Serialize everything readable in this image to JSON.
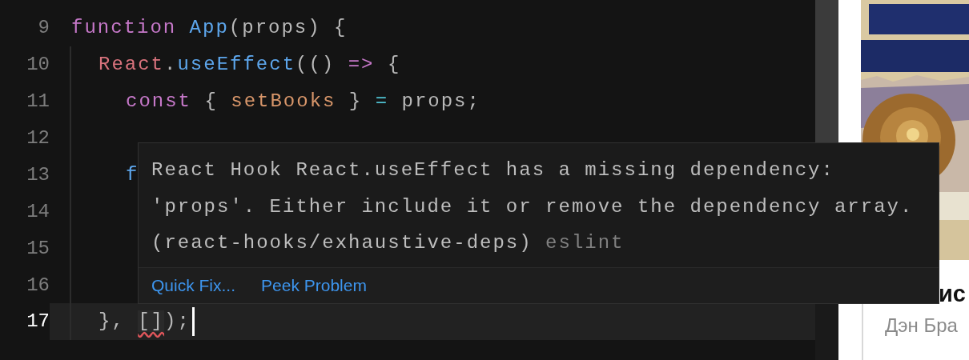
{
  "editor": {
    "lines": [
      {
        "number": "9",
        "current": false,
        "tokens": [
          {
            "text": "function",
            "kind": "keyword",
            "error": false
          },
          {
            "text": " App",
            "kind": "function",
            "error": false
          },
          {
            "text": "(props) {",
            "kind": "punctuation",
            "error": false
          }
        ],
        "children": [
          {
            "number": "10",
            "current": false,
            "tokens": [
              {
                "text": "React",
                "kind": "object",
                "error": false
              },
              {
                "text": ".",
                "kind": "punctuation",
                "error": false
              },
              {
                "text": "useEffect",
                "kind": "function",
                "error": false
              },
              {
                "text": "(()",
                "kind": "punctuation",
                "error": false
              },
              {
                "text": " =>",
                "kind": "keyword",
                "error": false
              },
              {
                "text": " {",
                "kind": "punctuation",
                "error": false
              }
            ],
            "children": [
              {
                "number": "11",
                "current": false,
                "tokens": [
                  {
                    "text": "const",
                    "kind": "keyword",
                    "error": false
                  },
                  {
                    "text": " {",
                    "kind": "punctuation",
                    "error": false
                  },
                  {
                    "text": " setBooks",
                    "kind": "variable",
                    "error": false
                  },
                  {
                    "text": " }",
                    "kind": "punctuation",
                    "error": false
                  },
                  {
                    "text": " =",
                    "kind": "operator",
                    "error": false
                  },
                  {
                    "text": " props;",
                    "kind": "punctuation",
                    "error": false
                  }
                ]
              },
              {
                "number": "12",
                "current": false
              },
              {
                "number": "13",
                "current": false,
                "tokens": [
                  {
                    "text": "f",
                    "kind": "function",
                    "error": false
                  }
                ]
              },
              {
                "number": "14",
                "current": false
              },
              {
                "number": "15",
                "current": false
              },
              {
                "number": "16",
                "current": false
              }
            ]
          },
          {
            "number": "17",
            "current": true,
            "tokens": [
              {
                "text": "}, ",
                "kind": "punctuation",
                "error": false
              },
              {
                "text": "[]",
                "kind": "punctuation",
                "error": true
              },
              {
                "text": ");",
                "kind": "punctuation",
                "error": false
              }
            ]
          }
        ]
      }
    ]
  },
  "hover": {
    "message": "React Hook React.useEffect has a missing dependency: 'props'. Either include it or remove the dependency array. (react-hooks/exhaustive-deps)",
    "source": "eslint",
    "actions": [
      {
        "label": "Quick Fix..."
      },
      {
        "label": "Peek Problem"
      }
    ]
  },
  "page": {
    "title": "ис",
    "author": "Дэн Бра"
  }
}
